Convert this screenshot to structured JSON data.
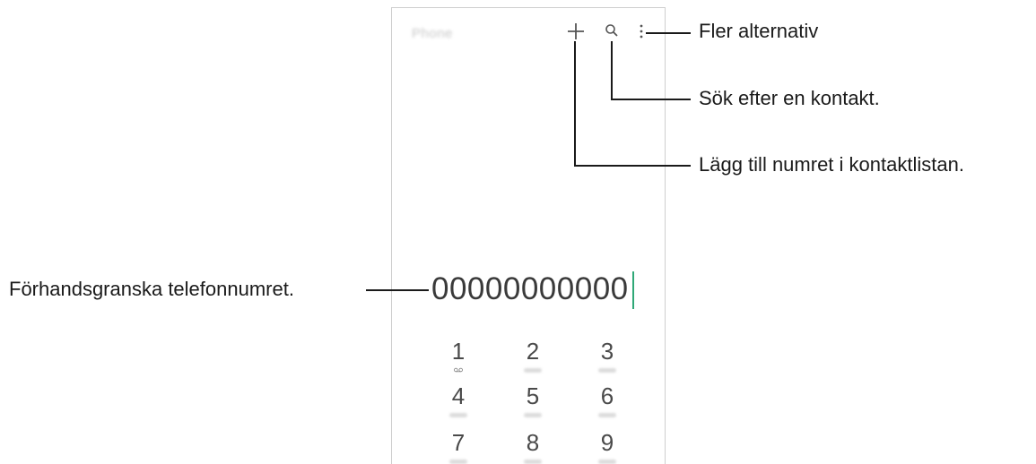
{
  "phone": {
    "app_title": "Phone",
    "icons": {
      "add": "plus-icon",
      "search": "search-icon",
      "more": "more-options-icon"
    },
    "number": "00000000000",
    "keypad": [
      {
        "digit": "1",
        "sub": "voicemail-icon"
      },
      {
        "digit": "2",
        "sub": ""
      },
      {
        "digit": "3",
        "sub": ""
      },
      {
        "digit": "4",
        "sub": ""
      },
      {
        "digit": "5",
        "sub": ""
      },
      {
        "digit": "6",
        "sub": ""
      },
      {
        "digit": "7",
        "sub": ""
      },
      {
        "digit": "8",
        "sub": ""
      },
      {
        "digit": "9",
        "sub": ""
      }
    ]
  },
  "callouts": {
    "more_options": "Fler alternativ",
    "search_contact": "Sök efter en kontakt.",
    "add_to_contacts": "Lägg till numret i kontaktlistan.",
    "preview_number": "Förhandsgranska telefonnumret."
  },
  "colors": {
    "cursor": "#2fa877",
    "frame": "#cfcfcf",
    "text": "#1a1a1a"
  }
}
